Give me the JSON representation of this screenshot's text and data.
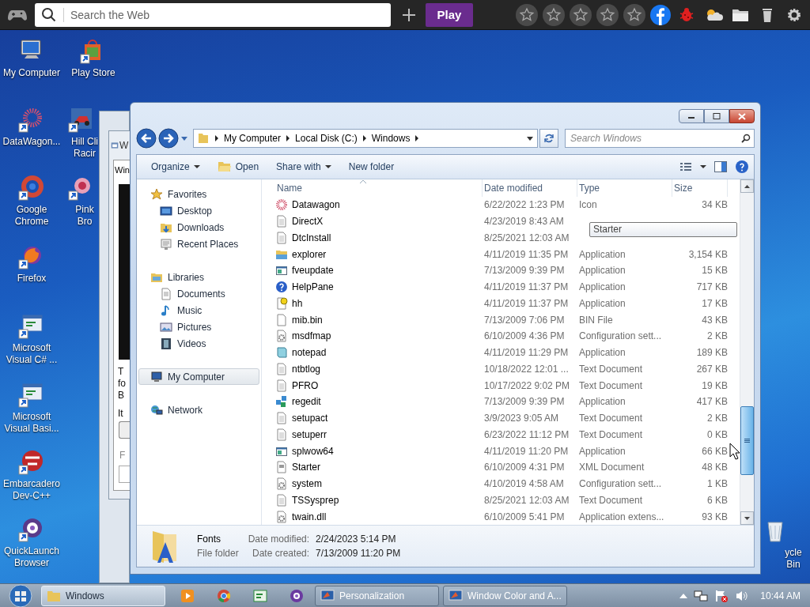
{
  "top_bar": {
    "search_placeholder": "Search the Web",
    "play": "Play"
  },
  "desktop_icons": [
    {
      "label": "My Computer",
      "kind": "monitor",
      "shortcut": false
    },
    {
      "label": "Play Store",
      "kind": "bag",
      "shortcut": true
    },
    {
      "label": "DataWagon...",
      "kind": "flower",
      "shortcut": true
    },
    {
      "label": "Hill Cli Racir",
      "kind": "car",
      "shortcut": true
    },
    {
      "label": "Google Chrome",
      "kind": "ring",
      "shortcut": true
    },
    {
      "label": "Pink Bro",
      "kind": "pink-flower",
      "shortcut": true
    },
    {
      "label": "Firefox",
      "kind": "flame",
      "shortcut": true
    },
    {
      "label": "Microsoft Visual C# ...",
      "kind": "code-window",
      "shortcut": true
    },
    {
      "label": "Microsoft Visual Basi...",
      "kind": "code-window",
      "shortcut": true
    },
    {
      "label": "Embarcadero Dev-C++",
      "kind": "dev-badge",
      "shortcut": true
    },
    {
      "label": "QuickLaunch Browser",
      "kind": "target",
      "shortcut": true
    },
    {
      "label": "ycle Bin",
      "kind": "recycle-bin",
      "shortcut": false
    }
  ],
  "back_window": {
    "title": "W",
    "tab": "Win",
    "lines": [
      "T",
      "fo",
      "B"
    ],
    "label": "It",
    "faded_label": "F"
  },
  "explorer": {
    "address": [
      "My Computer",
      "Local Disk (C:)",
      "Windows"
    ],
    "search_placeholder": "Search Windows",
    "commands": [
      {
        "label": "Organize",
        "kind": "menu"
      },
      {
        "label": "Open",
        "kind": "open"
      },
      {
        "label": "Share with",
        "kind": "menu"
      },
      {
        "label": "New folder",
        "kind": "plain"
      }
    ],
    "nav": [
      {
        "label": "Favorites",
        "kind": "star",
        "selected": false,
        "children": [
          {
            "label": "Desktop",
            "kind": "desktop",
            "selected": false
          },
          {
            "label": "Downloads",
            "kind": "downloads",
            "selected": false
          },
          {
            "label": "Recent Places",
            "kind": "recent",
            "selected": false
          }
        ]
      },
      {
        "label": "Libraries",
        "kind": "library",
        "selected": false,
        "children": [
          {
            "label": "Documents",
            "kind": "documents",
            "selected": false
          },
          {
            "label": "Music",
            "kind": "music",
            "selected": false
          },
          {
            "label": "Pictures",
            "kind": "pictures",
            "selected": false
          },
          {
            "label": "Videos",
            "kind": "videos",
            "selected": false
          }
        ]
      },
      {
        "label": "My Computer",
        "kind": "computer",
        "selected": true
      },
      {
        "label": "Network",
        "kind": "network",
        "selected": false
      }
    ],
    "columns": [
      "Name",
      "Date modified",
      "Type",
      "Size"
    ],
    "rows": [
      {
        "name": "Datawagon",
        "date": "6/22/2022 1:23 PM",
        "type": "Icon",
        "size": "34 KB",
        "kind": "icon"
      },
      {
        "name": "DirectX",
        "date": "4/23/2019 8:43 AM",
        "kind": "text"
      },
      {
        "name": "DtcInstall",
        "date": "8/25/2021 12:03 AM",
        "kind": "text"
      },
      {
        "name": "explorer",
        "date": "4/11/2019 11:35 PM",
        "type": "Application",
        "size": "3,154 KB",
        "kind": "explorer"
      },
      {
        "name": "fveupdate",
        "date": "7/13/2009 9:39 PM",
        "type": "Application",
        "size": "15 KB",
        "kind": "window-app"
      },
      {
        "name": "HelpPane",
        "date": "4/11/2019 11:37 PM",
        "type": "Application",
        "size": "717 KB",
        "kind": "help"
      },
      {
        "name": "hh",
        "date": "4/11/2019 11:37 PM",
        "type": "Application",
        "size": "17 KB",
        "kind": "hh"
      },
      {
        "name": "mib.bin",
        "date": "7/13/2009 7:06 PM",
        "type": "BIN File",
        "size": "43 KB",
        "kind": "file"
      },
      {
        "name": "msdfmap",
        "date": "6/10/2009 4:36 PM",
        "type": "Configuration sett...",
        "size": "2 KB",
        "kind": "config"
      },
      {
        "name": "notepad",
        "date": "4/11/2019 11:29 PM",
        "type": "Application",
        "size": "189 KB",
        "kind": "notepad"
      },
      {
        "name": "ntbtlog",
        "date": "10/18/2022 12:01 ...",
        "type": "Text Document",
        "size": "267 KB",
        "kind": "text"
      },
      {
        "name": "PFRO",
        "date": "10/17/2022 9:02 PM",
        "type": "Text Document",
        "size": "19 KB",
        "kind": "text"
      },
      {
        "name": "regedit",
        "date": "7/13/2009 9:39 PM",
        "type": "Application",
        "size": "417 KB",
        "kind": "regedit"
      },
      {
        "name": "setupact",
        "date": "3/9/2023 9:05 AM",
        "type": "Text Document",
        "size": "2 KB",
        "kind": "text"
      },
      {
        "name": "setuperr",
        "date": "6/23/2022 11:12 PM",
        "type": "Text Document",
        "size": "0 KB",
        "kind": "text"
      },
      {
        "name": "splwow64",
        "date": "4/11/2019 11:20 PM",
        "type": "Application",
        "size": "66 KB",
        "kind": "window-app"
      },
      {
        "name": "Starter",
        "date": "6/10/2009 4:31 PM",
        "type": "XML Document",
        "size": "48 KB",
        "kind": "xml"
      },
      {
        "name": "system",
        "date": "4/10/2019 4:58 AM",
        "type": "Configuration sett...",
        "size": "1 KB",
        "kind": "config"
      },
      {
        "name": "TSSysprep",
        "date": "8/25/2021 12:03 AM",
        "type": "Text Document",
        "size": "6 KB",
        "kind": "text"
      },
      {
        "name": "twain.dll",
        "date": "6/10/2009 5:41 PM",
        "type": "Application extens...",
        "size": "93 KB",
        "kind": "config"
      }
    ],
    "tooltip": "Starter",
    "details": {
      "name": "Fonts",
      "type": "File folder",
      "properties": [
        {
          "label": "Date modified:",
          "value": "2/24/2023 5:14 PM"
        },
        {
          "label": "Date created:",
          "value": "7/13/2009 11:20 PM"
        }
      ]
    }
  },
  "taskbar": {
    "items": [
      {
        "kind": "folder-window",
        "label": "Windows",
        "selected": true
      },
      {
        "kind": "media"
      },
      {
        "kind": "browser"
      },
      {
        "kind": "code"
      },
      {
        "kind": "disc"
      },
      {
        "kind": "display-window",
        "label": "Personalization",
        "selected": false
      },
      {
        "kind": "display-window",
        "label": "Window Color and A...",
        "selected": false
      }
    ],
    "clock": "10:44 AM"
  }
}
